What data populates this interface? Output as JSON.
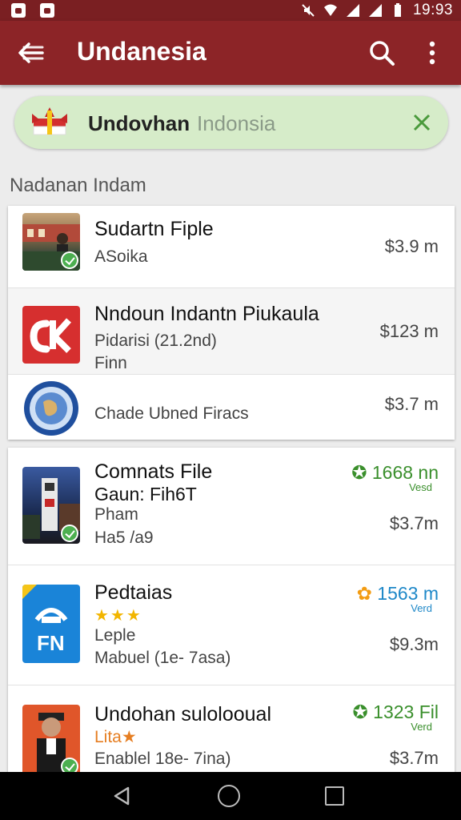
{
  "status_bar": {
    "time": "19:93"
  },
  "app_bar": {
    "title": "Undanesia"
  },
  "chip": {
    "bold_text": "Undovhan",
    "light_text": "Indonsia"
  },
  "section_title": "Nadanan Indam",
  "group1": [
    {
      "title": "Sudartn Fiple",
      "subtitle": "ASoika",
      "price": "$3.9 m"
    },
    {
      "title": "Nndoun Indantn Piukaula",
      "subtitle": "Pidarisi (21.2nd)",
      "subtitle2": "Finn",
      "price": "$123 m"
    },
    {
      "subtitle": "Chade Ubned Firacs",
      "price": "$3.7 m"
    }
  ],
  "group2": [
    {
      "title": "Comnats File",
      "line2": "Gaun: Fih6T",
      "line3": "Pham",
      "line4": "Ha5 /a9",
      "rating": "1668 nn",
      "rating_label": "Vesd",
      "price": "$3.7m"
    },
    {
      "title": "Pedtaias",
      "stars": "★★★",
      "line3": "Leple",
      "line4": "Mabuel (1e- 7asa)",
      "rating": "1563 m",
      "rating_label": "Verd",
      "price": "$9.3m",
      "logo_text": "FN"
    },
    {
      "title": "Undohan sulolooual",
      "line2": "Lita★",
      "line4": "Enablel 18e- 7ina)",
      "rating": "1323 Fil",
      "rating_label": "Verd",
      "price": "$3.7m"
    }
  ]
}
